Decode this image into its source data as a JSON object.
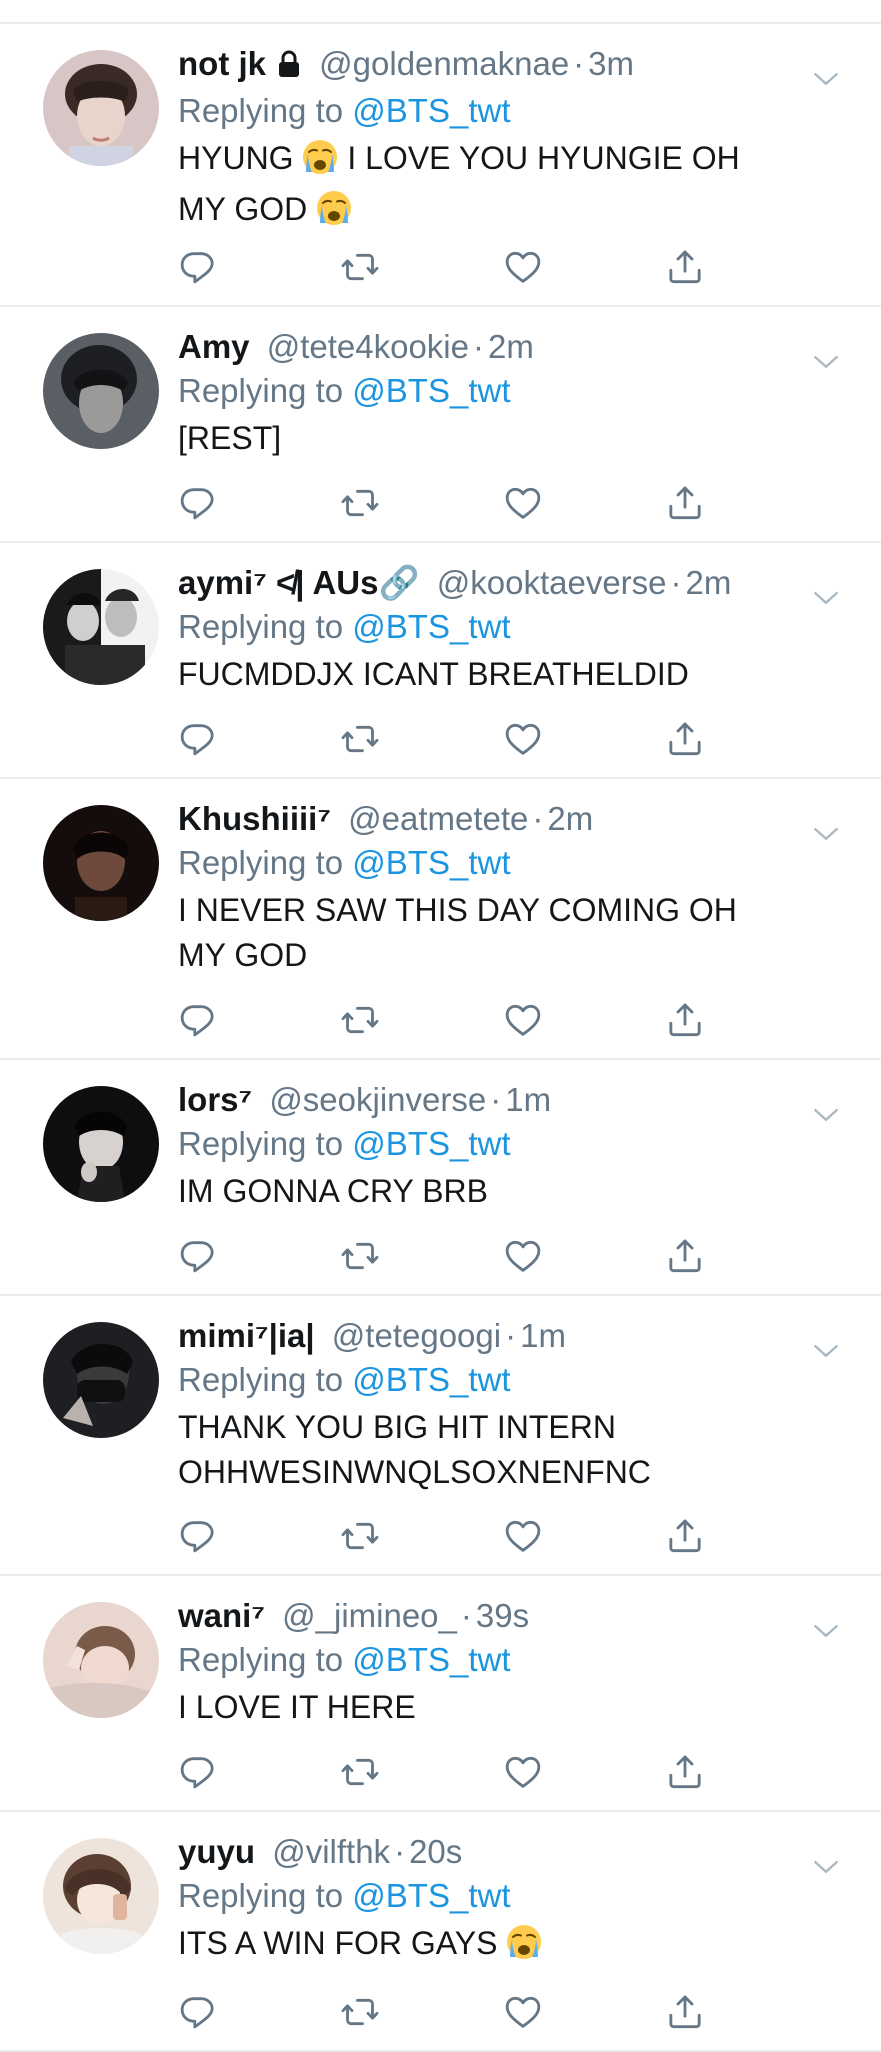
{
  "colors": {
    "link_blue": "#1b95e0",
    "secondary_grey": "#657786",
    "divider": "#e6ecf0",
    "text": "#14171a"
  },
  "icons": {
    "reply": "reply-icon",
    "retweet": "retweet-icon",
    "like": "like-icon",
    "share": "share-icon",
    "caret": "chevron-down-icon",
    "protected": "lock-icon"
  },
  "tweets": [
    {
      "name": "not jk",
      "handle": "@goldenmaknae",
      "separator": "·",
      "time": "3m",
      "replying_prefix": "Replying to",
      "replying_to": "@BTS_twt",
      "text_line1": "HYUNG",
      "text_line1b": "I LOVE YOU HYUNGIE OH",
      "text_line2": "MY GOD"
    },
    {
      "name": "Amy",
      "handle": "@tete4kookie",
      "separator": "·",
      "time": "2m",
      "replying_prefix": "Replying to",
      "replying_to": "@BTS_twt",
      "text": "[REST]"
    },
    {
      "name": "aymi⁷ ≮| AUs🔗",
      "handle": "@kooktaeverse",
      "separator": "·",
      "time": "2m",
      "replying_prefix": "Replying to",
      "replying_to": "@BTS_twt",
      "text": "FUCMDDJX ICANT BREATHELDID"
    },
    {
      "name": "Khushiiii⁷",
      "handle": "@eatmetete",
      "separator": "·",
      "time": "2m",
      "replying_prefix": "Replying to",
      "replying_to": "@BTS_twt",
      "text_line1": "I NEVER SAW THIS DAY COMING OH",
      "text_line2": "MY GOD"
    },
    {
      "name": "lors⁷",
      "handle": "@seokjinverse",
      "separator": "·",
      "time": "1m",
      "replying_prefix": "Replying to",
      "replying_to": "@BTS_twt",
      "text": "IM GONNA CRY BRB"
    },
    {
      "name": "mimi⁷|ia|",
      "handle": "@tetegoogi",
      "separator": "·",
      "time": "1m",
      "replying_prefix": "Replying to",
      "replying_to": "@BTS_twt",
      "text_line1": "THANK YOU BIG HIT INTERN",
      "text_line2": "OHHWESINWNQLSOXNENFNC"
    },
    {
      "name": "wani⁷",
      "handle": "@_jimineo_",
      "separator": "·",
      "time": "39s",
      "replying_prefix": "Replying to",
      "replying_to": "@BTS_twt",
      "text": "I LOVE IT HERE"
    },
    {
      "name": "yuyu",
      "handle": "@vilfthk",
      "separator": "·",
      "time": "20s",
      "replying_prefix": "Replying to",
      "replying_to": "@BTS_twt",
      "text": "ITS A WIN FOR GAYS"
    }
  ]
}
